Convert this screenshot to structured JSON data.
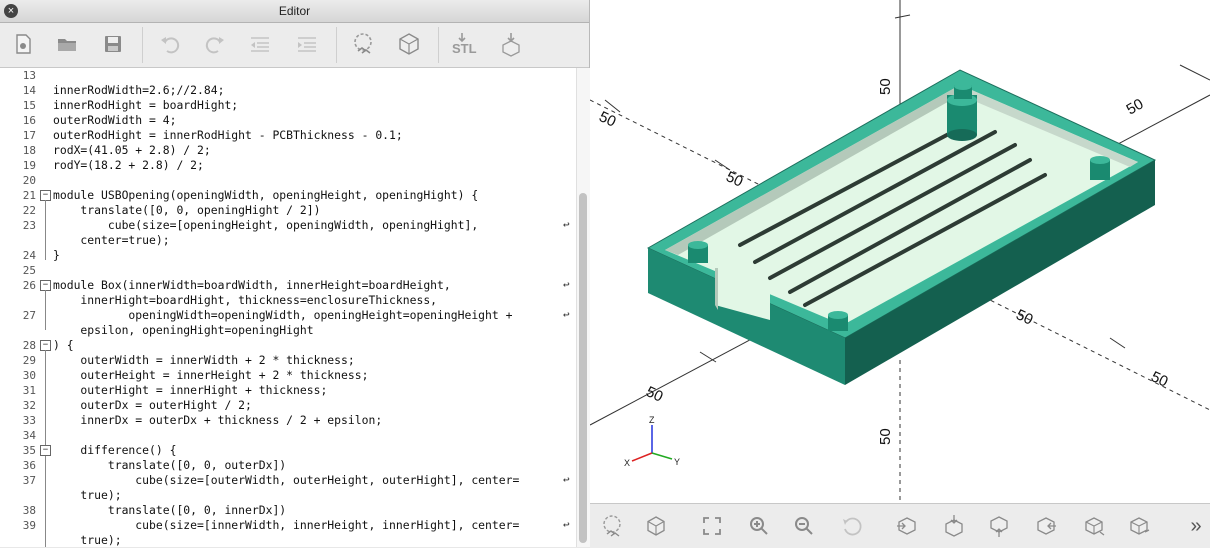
{
  "window": {
    "title": "Editor"
  },
  "toolbar": {
    "icons": [
      "new-file-icon",
      "open-file-icon",
      "save-icon",
      "undo-icon",
      "redo-icon",
      "unindent-icon",
      "indent-icon",
      "preview-icon",
      "render-icon",
      "export-stl-icon",
      "send-to-3d-print-icon"
    ],
    "stl_label": "STL"
  },
  "editor": {
    "lines": [
      {
        "n": "13",
        "text": ""
      },
      {
        "n": "14",
        "text": "innerRodWidth=2.6;//2.84;"
      },
      {
        "n": "15",
        "text": "innerRodHight = boardHight;"
      },
      {
        "n": "16",
        "text": "outerRodWidth = 4;"
      },
      {
        "n": "17",
        "text": "outerRodHight = innerRodHight - PCBThickness - 0.1;"
      },
      {
        "n": "18",
        "text": "rodX=(41.05 + 2.8) / 2;"
      },
      {
        "n": "19",
        "text": "rodY=(18.2 + 2.8) / 2;"
      },
      {
        "n": "20",
        "text": ""
      },
      {
        "n": "21",
        "text": "module USBOpening(openingWidth, openingHeight, openingHight) {"
      },
      {
        "n": "22",
        "text": "    translate([0, 0, openingHight / 2])"
      },
      {
        "n": "23",
        "text": "        cube(size=[openingHeight, openingWidth, openingHight],"
      },
      {
        "n": "",
        "text": "    center=true);"
      },
      {
        "n": "24",
        "text": "}"
      },
      {
        "n": "25",
        "text": ""
      },
      {
        "n": "26",
        "text": "module Box(innerWidth=boardWidth, innerHeight=boardHeight,"
      },
      {
        "n": "",
        "text": "    innerHight=boardHight, thickness=enclosureThickness,"
      },
      {
        "n": "27",
        "text": "           openingWidth=openingWidth, openingHeight=openingHeight +"
      },
      {
        "n": "",
        "text": "    epsilon, openingHight=openingHight"
      },
      {
        "n": "28",
        "text": ") {"
      },
      {
        "n": "29",
        "text": "    outerWidth = innerWidth + 2 * thickness;"
      },
      {
        "n": "30",
        "text": "    outerHeight = innerHeight + 2 * thickness;"
      },
      {
        "n": "31",
        "text": "    outerHight = innerHight + thickness;"
      },
      {
        "n": "32",
        "text": "    outerDx = outerHight / 2;"
      },
      {
        "n": "33",
        "text": "    innerDx = outerDx + thickness / 2 + epsilon;"
      },
      {
        "n": "34",
        "text": ""
      },
      {
        "n": "35",
        "text": "    difference() {"
      },
      {
        "n": "36",
        "text": "        translate([0, 0, outerDx])"
      },
      {
        "n": "37",
        "text": "            cube(size=[outerWidth, outerHeight, outerHight], center="
      },
      {
        "n": "",
        "text": "    true);"
      },
      {
        "n": "38",
        "text": "        translate([0, 0, innerDx])"
      },
      {
        "n": "39",
        "text": "            cube(size=[innerWidth, innerHeight, innerHight], center="
      },
      {
        "n": "",
        "text": "    true);"
      }
    ],
    "wrap_marker": "↩",
    "fold_marker": "−"
  },
  "viewport": {
    "axis_labels": [
      "50",
      "50",
      "50",
      "50",
      "50",
      "50",
      "50",
      "50"
    ],
    "axes_indicator": {
      "x": "X",
      "y": "Y",
      "z": "Z"
    },
    "colors": {
      "model_top": "#3cb89a",
      "model_side": "#1e8a72",
      "model_dark": "#14604f",
      "interior": "#e2f7e6",
      "inner_wall": "#b4c9ba"
    }
  },
  "viewbar": {
    "icons": [
      "preview-icon",
      "render-icon",
      "view-all-icon",
      "zoom-in-icon",
      "zoom-out-icon",
      "reset-view-icon",
      "view-right-icon",
      "view-top-icon",
      "view-bottom-icon",
      "view-left-icon",
      "view-front-icon",
      "view-back-icon",
      "more-icon"
    ],
    "more_label": "»"
  }
}
